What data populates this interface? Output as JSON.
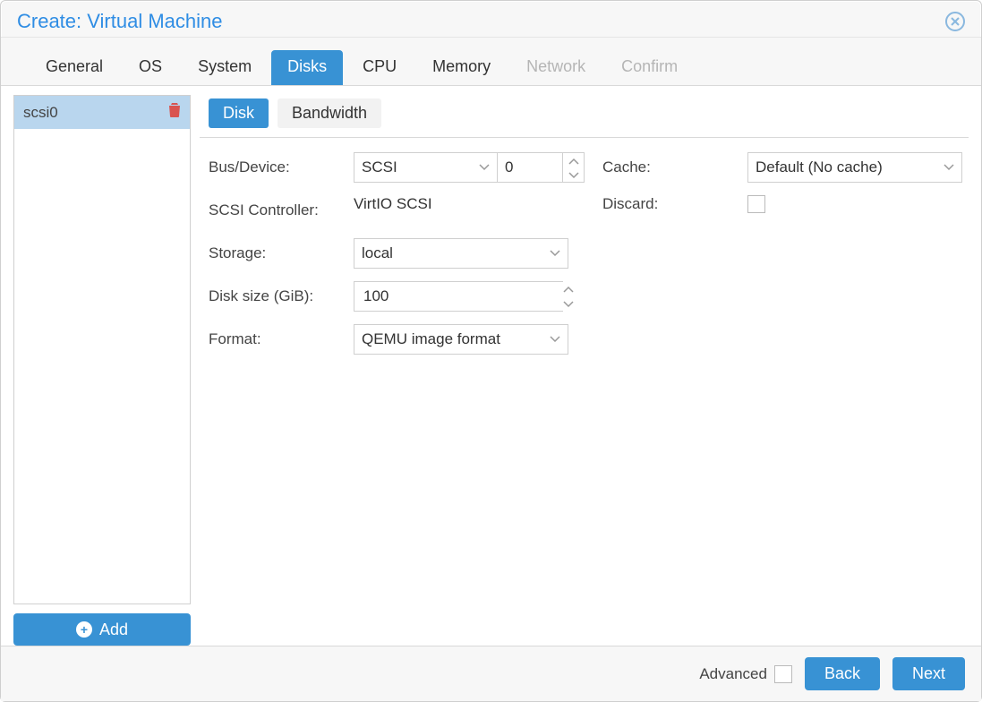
{
  "window": {
    "title": "Create: Virtual Machine"
  },
  "tabs": [
    {
      "label": "General",
      "state": "normal"
    },
    {
      "label": "OS",
      "state": "normal"
    },
    {
      "label": "System",
      "state": "normal"
    },
    {
      "label": "Disks",
      "state": "active"
    },
    {
      "label": "CPU",
      "state": "normal"
    },
    {
      "label": "Memory",
      "state": "normal"
    },
    {
      "label": "Network",
      "state": "disabled"
    },
    {
      "label": "Confirm",
      "state": "disabled"
    }
  ],
  "sidebar": {
    "items": [
      {
        "label": "scsi0",
        "selected": true
      }
    ],
    "add_label": "Add"
  },
  "subtabs": {
    "disk": {
      "label": "Disk",
      "active": true
    },
    "bandwidth": {
      "label": "Bandwidth",
      "active": false
    }
  },
  "form": {
    "bus_device": {
      "label": "Bus/Device:",
      "bus": "SCSI",
      "device": "0"
    },
    "controller": {
      "label": "SCSI Controller:",
      "value": "VirtIO SCSI"
    },
    "storage": {
      "label": "Storage:",
      "value": "local"
    },
    "disk_size": {
      "label": "Disk size (GiB):",
      "value": "100"
    },
    "format": {
      "label": "Format:",
      "value": "QEMU image format"
    },
    "cache": {
      "label": "Cache:",
      "value": "Default (No cache)"
    },
    "discard": {
      "label": "Discard:",
      "checked": false
    }
  },
  "footer": {
    "advanced_label": "Advanced",
    "advanced_checked": false,
    "back_label": "Back",
    "next_label": "Next"
  }
}
